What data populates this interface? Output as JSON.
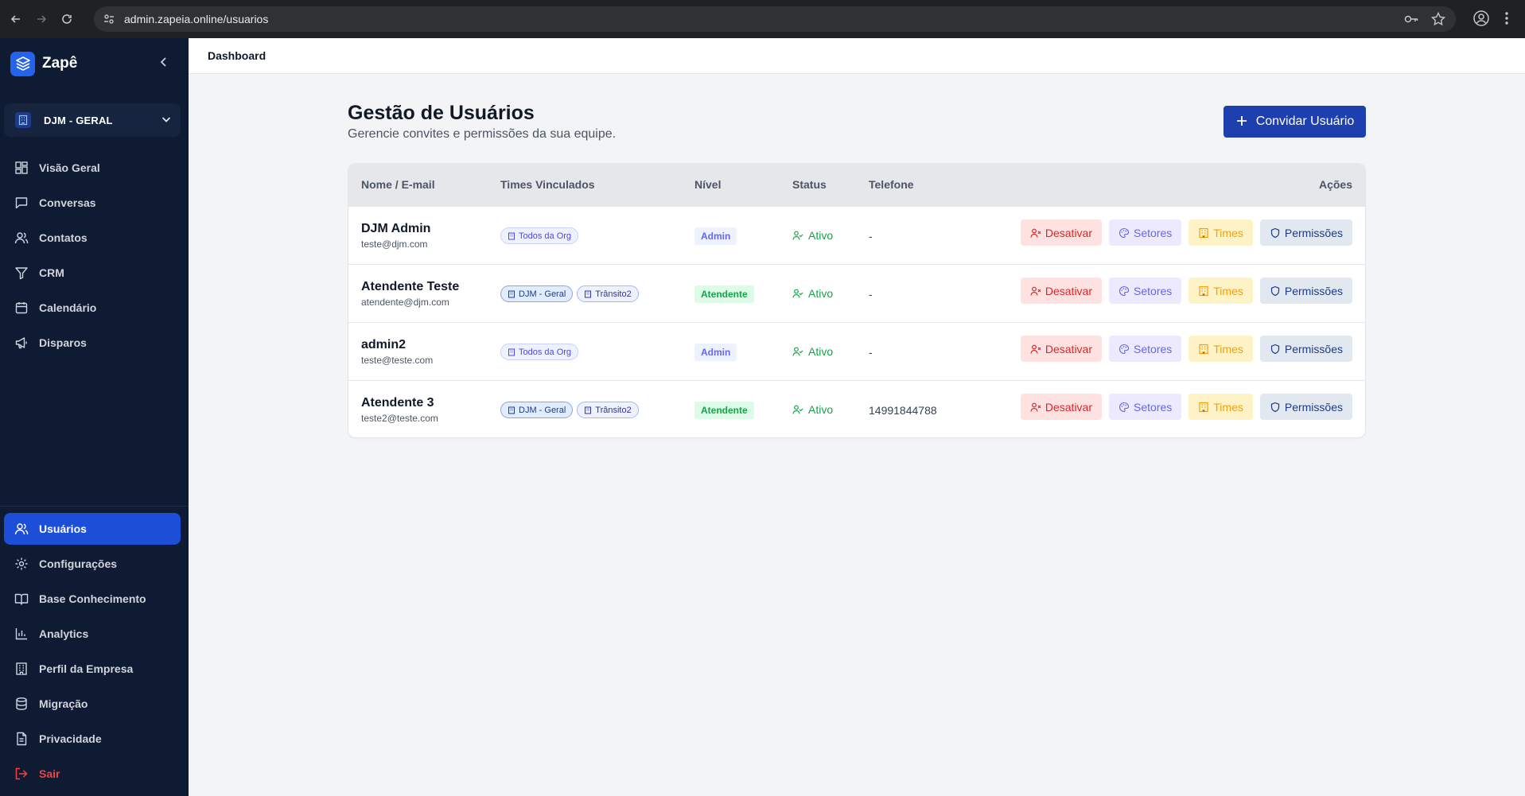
{
  "browser": {
    "url": "admin.zapeia.online/usuarios"
  },
  "sidebar": {
    "brand": "Zapê",
    "org": "DJM - GERAL",
    "nav_top": [
      {
        "label": "Visão Geral",
        "icon": "grid-icon"
      },
      {
        "label": "Conversas",
        "icon": "chat-icon"
      },
      {
        "label": "Contatos",
        "icon": "users-icon"
      },
      {
        "label": "CRM",
        "icon": "filter-icon"
      },
      {
        "label": "Calendário",
        "icon": "calendar-icon"
      },
      {
        "label": "Disparos",
        "icon": "megaphone-icon"
      }
    ],
    "nav_bottom": [
      {
        "label": "Usuários",
        "icon": "users-icon",
        "active": true
      },
      {
        "label": "Configurações",
        "icon": "gear-icon"
      },
      {
        "label": "Base Conhecimento",
        "icon": "book-icon"
      },
      {
        "label": "Analytics",
        "icon": "bar-chart-icon"
      },
      {
        "label": "Perfil da Empresa",
        "icon": "building-icon"
      },
      {
        "label": "Migração",
        "icon": "database-icon"
      },
      {
        "label": "Privacidade",
        "icon": "document-icon"
      },
      {
        "label": "Sair",
        "icon": "logout-icon"
      }
    ]
  },
  "topbar": {
    "title": "Dashboard"
  },
  "page": {
    "title": "Gestão de Usuários",
    "subtitle": "Gerencie convites e permissões da sua equipe.",
    "invite_label": "Convidar Usuário"
  },
  "table": {
    "headers": {
      "name": "Nome / E-mail",
      "teams": "Times Vinculados",
      "level": "Nível",
      "status": "Status",
      "phone": "Telefone",
      "actions": "Ações"
    },
    "action_labels": {
      "deactivate": "Desativar",
      "sectors": "Setores",
      "teams": "Times",
      "permissions": "Permissões"
    },
    "rows": [
      {
        "name": "DJM Admin",
        "email": "teste@djm.com",
        "teams": [
          "Todos da Org"
        ],
        "level": "Admin",
        "status": "Ativo",
        "phone": "-"
      },
      {
        "name": "Atendente Teste",
        "email": "atendente@djm.com",
        "teams": [
          "DJM - Geral",
          "Trânsito2"
        ],
        "level": "Atendente",
        "status": "Ativo",
        "phone": "-"
      },
      {
        "name": "admin2",
        "email": "teste@teste.com",
        "teams": [
          "Todos da Org"
        ],
        "level": "Admin",
        "status": "Ativo",
        "phone": "-"
      },
      {
        "name": "Atendente 3",
        "email": "teste2@teste.com",
        "teams": [
          "DJM - Geral",
          "Trânsito2"
        ],
        "level": "Atendente",
        "status": "Ativo",
        "phone": "14991844788"
      }
    ]
  },
  "colors": {
    "sidebar_bg": "#0f1b33",
    "accent": "#1e40af",
    "active_nav": "#1d4ed8",
    "status_green": "#16a34a",
    "danger": "#dc2626"
  }
}
